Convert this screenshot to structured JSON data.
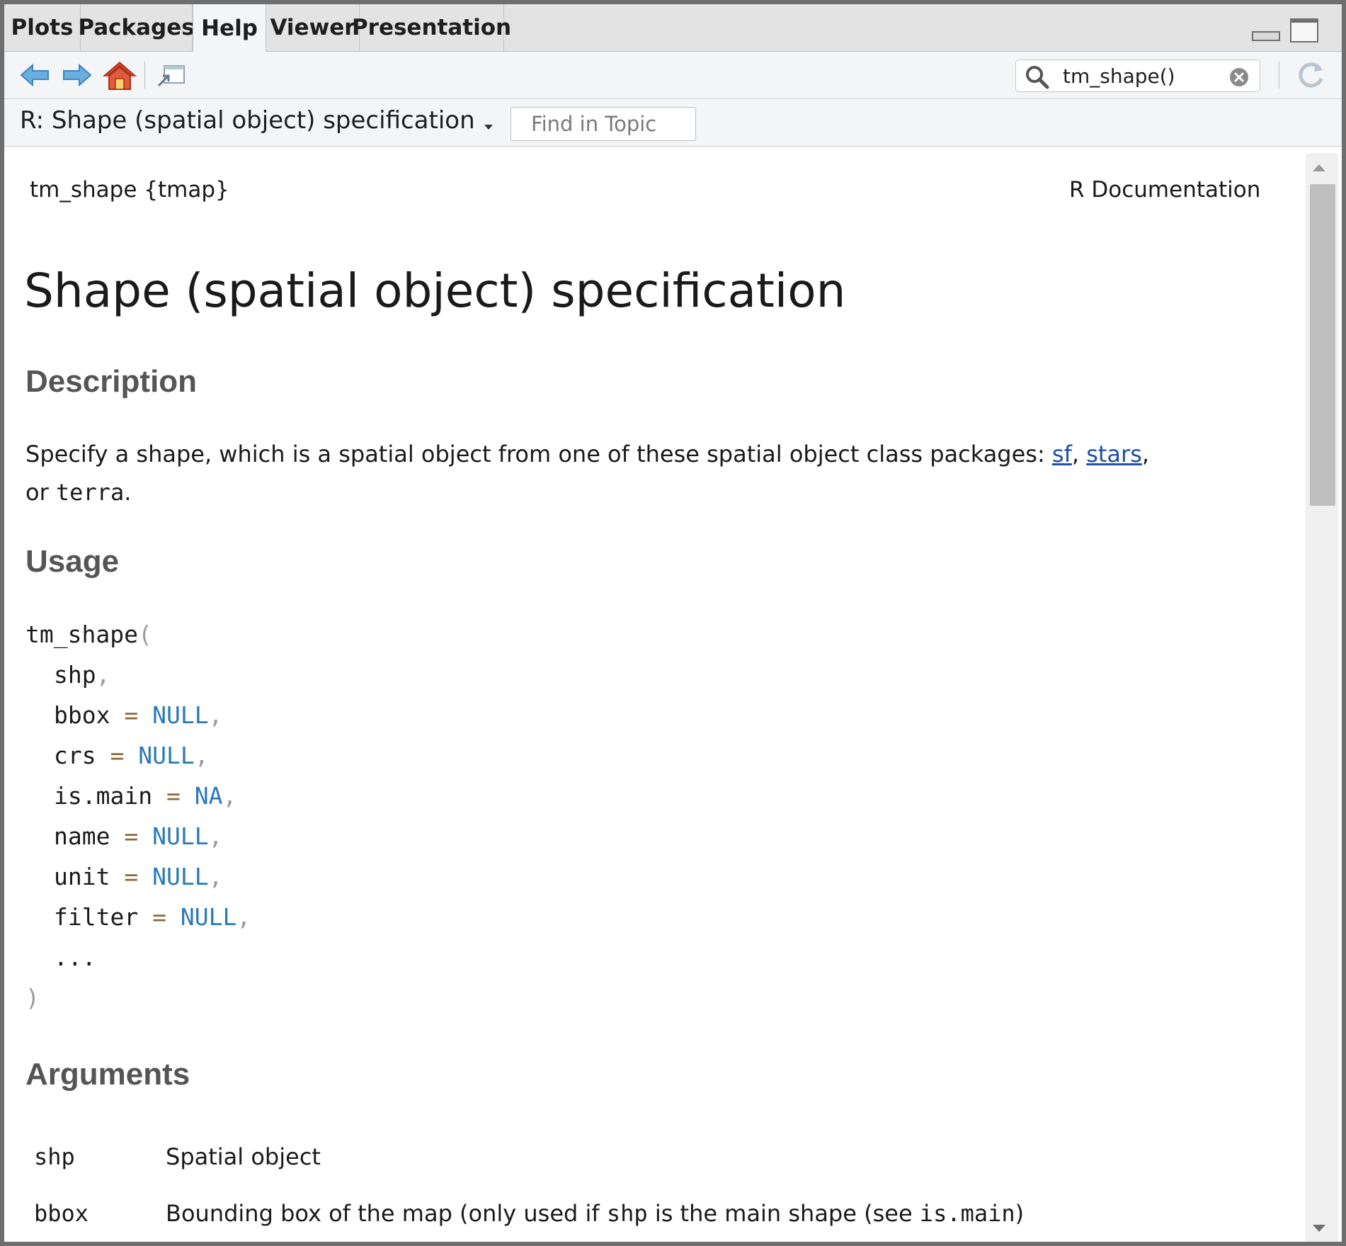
{
  "tabs": [
    {
      "label": "Plots",
      "active": false
    },
    {
      "label": "Packages",
      "active": false
    },
    {
      "label": "Help",
      "active": true
    },
    {
      "label": "Viewer",
      "active": false
    },
    {
      "label": "Presentation",
      "active": false
    }
  ],
  "toolbar": {
    "back_icon": "arrow-left-icon",
    "forward_icon": "arrow-right-icon",
    "home_icon": "home-icon",
    "popout_icon": "popout-window-icon",
    "search": {
      "value": "tm_shape()"
    },
    "refresh_icon": "refresh-icon"
  },
  "topic_bar": {
    "title": "R: Shape (spatial object) specification",
    "find_placeholder": "Find in Topic"
  },
  "doc": {
    "package": "tm_shape {tmap}",
    "rdoc": "R Documentation",
    "title": "Shape (spatial object) specification",
    "description_heading": "Description",
    "description_text": "Specify a shape, which is a spatial object from one of these spatial object class packages: ",
    "links": [
      "sf",
      "stars"
    ],
    "description_or": "or",
    "description_code": "terra",
    "usage_heading": "Usage",
    "usage": {
      "fn": "tm_shape",
      "open": "(",
      "close": ")",
      "args": [
        {
          "name": "shp",
          "default": ""
        },
        {
          "name": "bbox",
          "default": "NULL"
        },
        {
          "name": "crs",
          "default": "NULL"
        },
        {
          "name": "is.main",
          "default": "NA"
        },
        {
          "name": "name",
          "default": "NULL"
        },
        {
          "name": "unit",
          "default": "NULL"
        },
        {
          "name": "filter",
          "default": "NULL"
        }
      ],
      "dots": "..."
    },
    "arguments_heading": "Arguments",
    "arguments": [
      {
        "name": "shp",
        "desc": "Spatial object"
      },
      {
        "name": "bbox",
        "desc_pre": "Bounding box of the map (only used if ",
        "desc_code1": "shp",
        "desc_mid": " is the main shape (see ",
        "desc_code2": "is.main",
        "desc_post": ")"
      }
    ]
  },
  "colors": {
    "keyword": "#2a7ab8",
    "link": "#1f4ea8",
    "heading": "#555555"
  }
}
